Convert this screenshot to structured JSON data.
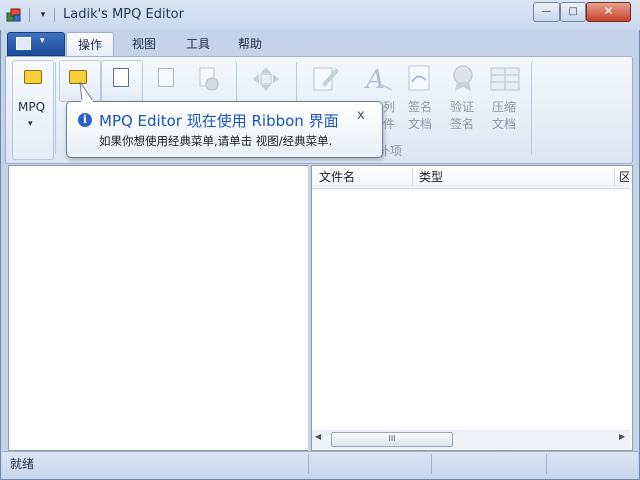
{
  "window": {
    "title": "Ladik's MPQ Editor",
    "qat_dropdown_glyph": "▾",
    "minimize_glyph": "—",
    "maximize_glyph": "□",
    "close_glyph": "✕"
  },
  "ribbon": {
    "app_menu_arrow": "▾",
    "tabs": [
      {
        "label": "操作",
        "active": true
      },
      {
        "label": "视图",
        "active": false
      },
      {
        "label": "工具",
        "active": false
      },
      {
        "label": "帮助",
        "active": false
      }
    ],
    "buttons": {
      "mpq_label": "MPQ",
      "mpq_arrow": "▾",
      "partial_col1_top": "列",
      "partial_col1_bottom": "件",
      "sign_label_1": "签名",
      "sign_label_2": "文档",
      "verify_label_1": "验证",
      "verify_label_2": "签名",
      "compress_label_1": "压缩",
      "compress_label_2": "文档",
      "group_label_partial": "补项"
    }
  },
  "tooltip": {
    "info_glyph": "i",
    "title": "MPQ Editor 现在使用 Ribbon 界面",
    "body": "如果你想使用经典菜单,请单击 视图/经典菜单.",
    "close_glyph": "x"
  },
  "file_list": {
    "columns": [
      "文件名",
      "类型",
      "区"
    ],
    "scroll_left": "◀",
    "scroll_right": "▶",
    "scroll_thumb_grip": "III"
  },
  "status_bar": {
    "text": "就绪"
  }
}
